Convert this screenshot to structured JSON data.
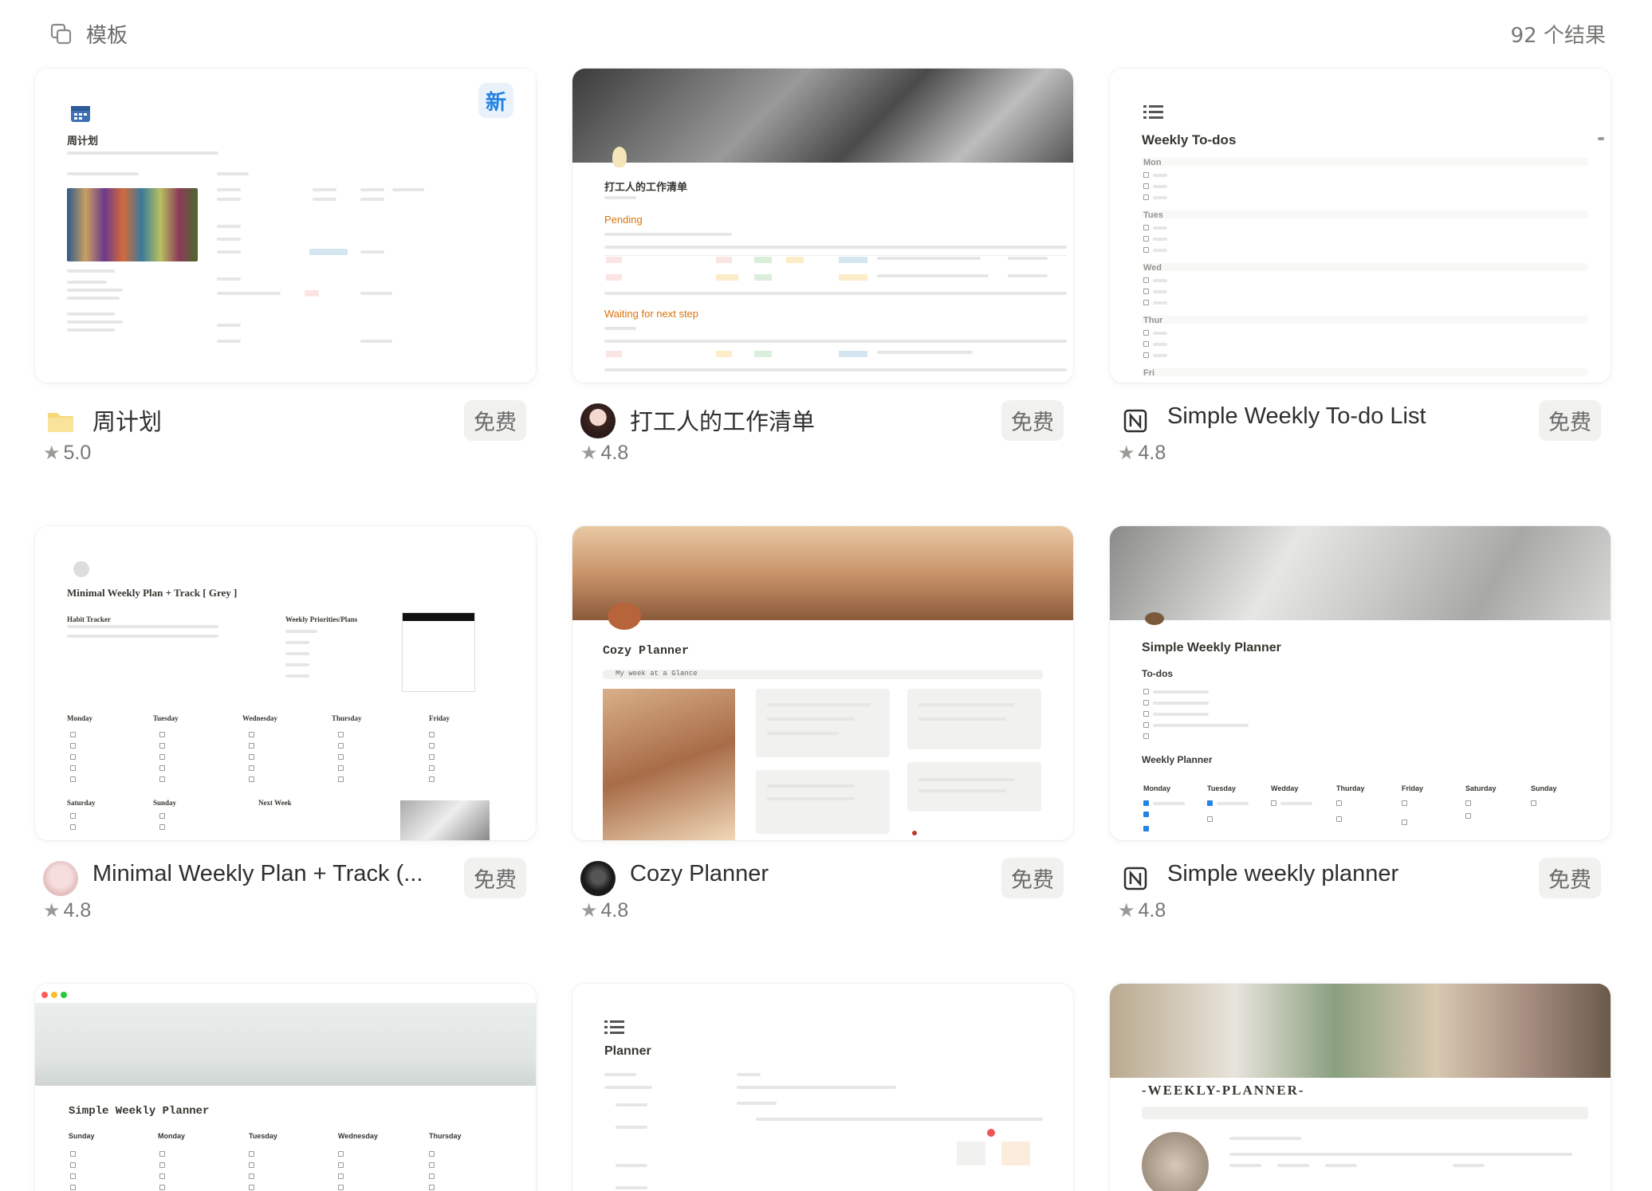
{
  "header": {
    "icon": "template-stack-icon",
    "title": "模板",
    "result_count": "92 个结果"
  },
  "cards": [
    {
      "name": "周计划",
      "price": "免费",
      "rating": "5.0",
      "badge": "新",
      "creator_icon": "yellow-folder-icon",
      "preview": {
        "title": "周计划"
      }
    },
    {
      "name": "打工人的工作清单",
      "price": "免费",
      "rating": "4.8",
      "creator_icon": "anime-avatar",
      "preview": {
        "title": "打工人的工作清单",
        "section1": "Pending",
        "section2": "Waiting for next step"
      }
    },
    {
      "name": "Simple Weekly To-do List",
      "price": "免费",
      "rating": "4.8",
      "creator_icon": "notion-logo-icon",
      "preview": {
        "title": "Weekly To-dos",
        "days": [
          "Mon",
          "Tues",
          "Wed",
          "Thur",
          "Fri"
        ]
      }
    },
    {
      "name": "Minimal Weekly Plan + Track (...",
      "price": "免费",
      "rating": "4.8",
      "creator_icon": "portrait-avatar",
      "preview": {
        "title": "Minimal Weekly Plan + Track [ Grey ]",
        "habit": "Habit Tracker",
        "priorities": "Weekly Priorities/Plans",
        "days": [
          "Monday",
          "Tuesday",
          "Wednesday",
          "Thursday",
          "Friday",
          "Saturday",
          "Sunday",
          "Next Week"
        ]
      }
    },
    {
      "name": "Cozy Planner",
      "price": "免费",
      "rating": "4.8",
      "creator_icon": "dark-avatar",
      "preview": {
        "title": "Cozy Planner",
        "subtitle": "My week at a Glance"
      }
    },
    {
      "name": "Simple weekly planner",
      "price": "免费",
      "rating": "4.8",
      "creator_icon": "notion-logo-icon",
      "preview": {
        "title": "Simple Weekly Planner",
        "todos": "To-dos",
        "weekly": "Weekly Planner",
        "days": [
          "Monday",
          "Tuesday",
          "Wedday",
          "Thurday",
          "Friday",
          "Saturday",
          "Sunday"
        ]
      }
    },
    {
      "preview": {
        "title": "Simple Weekly Planner",
        "days": [
          "Sunday",
          "Monday",
          "Tuesday",
          "Wednesday",
          "Thursday"
        ]
      }
    },
    {
      "preview": {
        "title": "Planner"
      }
    },
    {
      "preview": {
        "title": "-WEEKLY-PLANNER-"
      }
    }
  ],
  "colors": {
    "accent_badge": "#2383e2",
    "price_bg": "#f1f1ef",
    "text_muted": "#787774"
  }
}
